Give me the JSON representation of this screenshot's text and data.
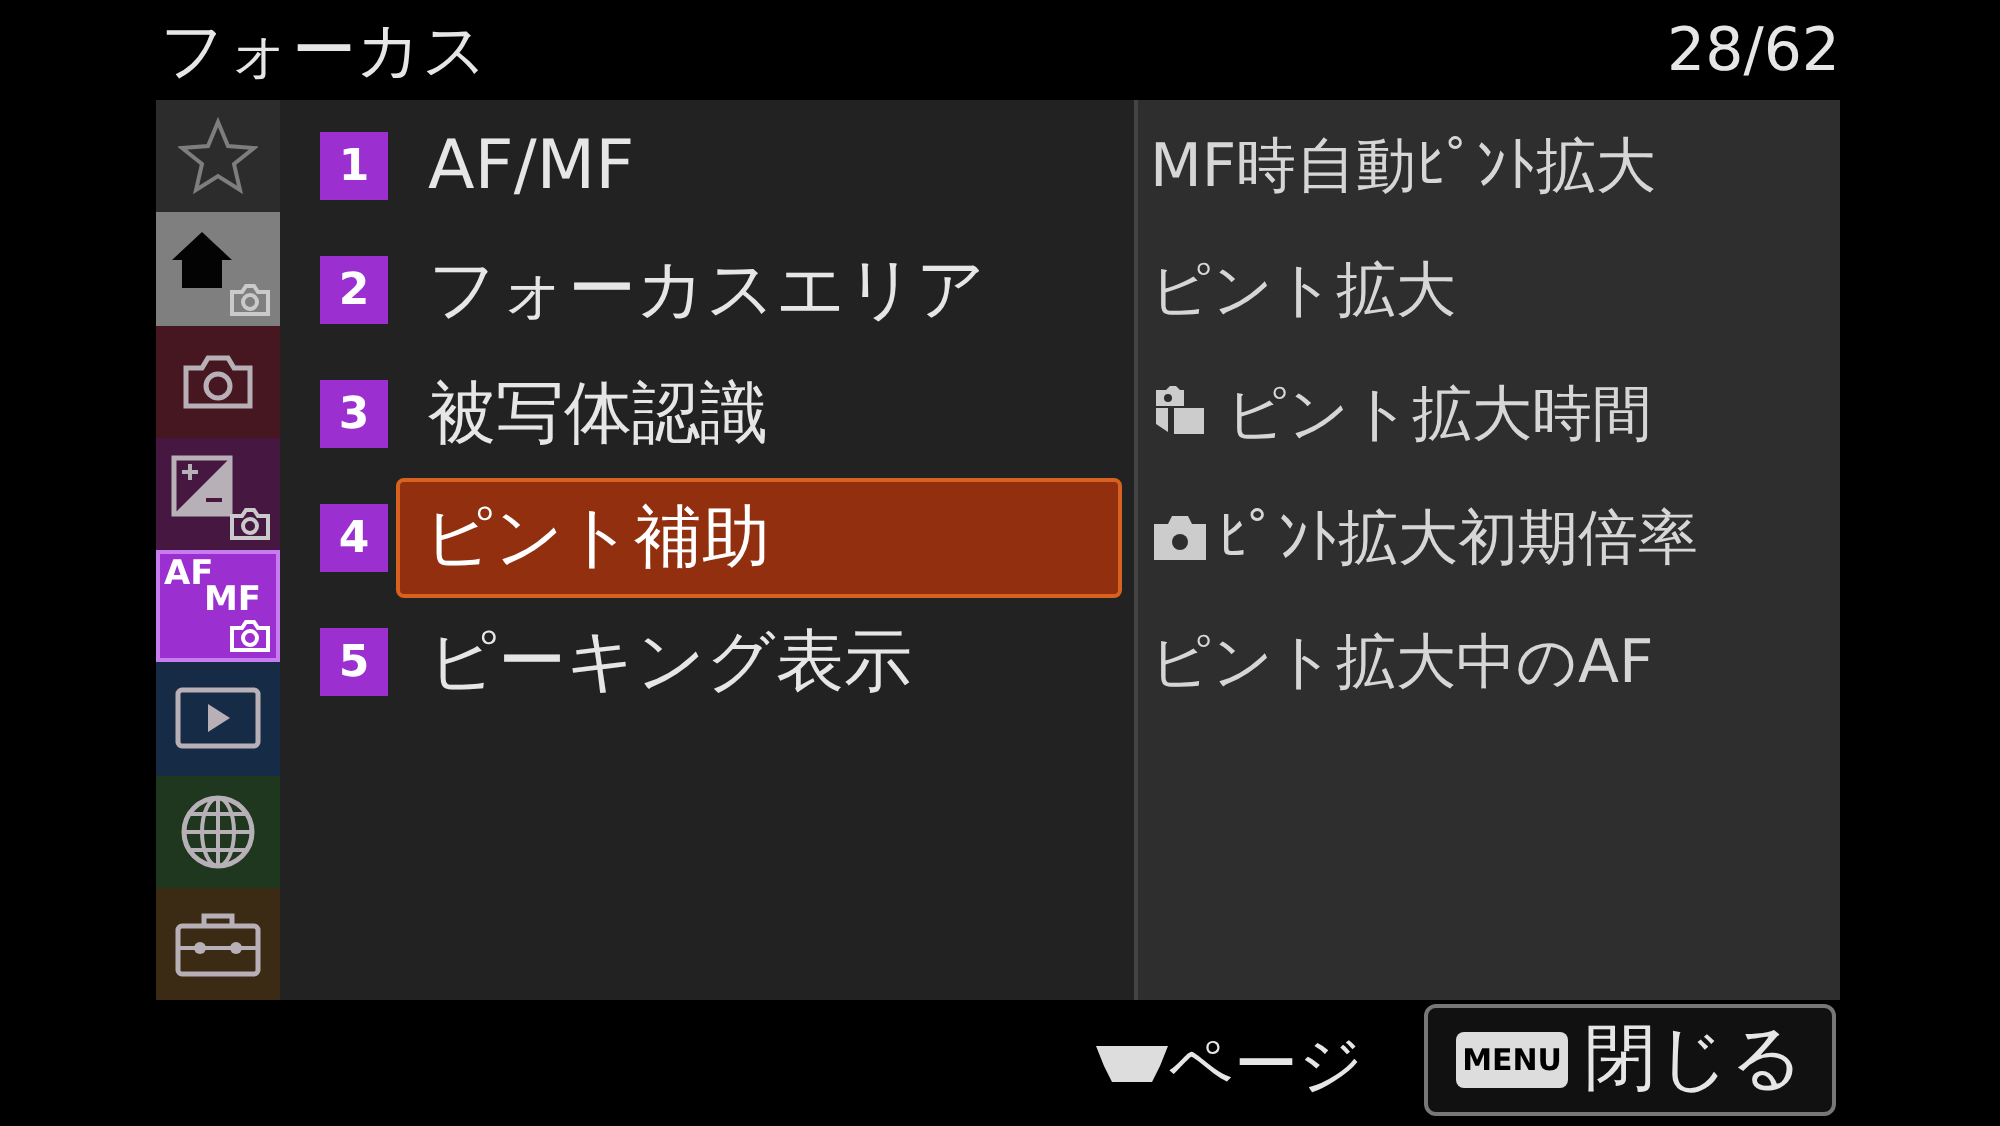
{
  "title": "フォーカス",
  "page_counter": "28/62",
  "tabs": [
    {
      "kind": "star",
      "color": "#2e2e2e",
      "selected": false
    },
    {
      "kind": "home",
      "color": "#8a8a8a",
      "selected": false
    },
    {
      "kind": "camera",
      "color": "#4a1620",
      "selected": false
    },
    {
      "kind": "exposure",
      "color": "#4a1845",
      "selected": false
    },
    {
      "kind": "afmf",
      "label_top": "AF",
      "label_bottom": "MF",
      "color": "#9b2fd0",
      "selected": true
    },
    {
      "kind": "play",
      "color": "#152e4a",
      "selected": false
    },
    {
      "kind": "globe",
      "color": "#1e3a1e",
      "selected": false
    },
    {
      "kind": "toolbox",
      "color": "#3e2c14",
      "selected": false
    }
  ],
  "items": [
    {
      "number": "1",
      "label": "AF/MF",
      "selected": false
    },
    {
      "number": "2",
      "label": "フォーカスエリア",
      "selected": false
    },
    {
      "number": "3",
      "label": "被写体認識",
      "selected": false
    },
    {
      "number": "4",
      "label": "ピント補助",
      "selected": true
    },
    {
      "number": "5",
      "label": "ピーキング表示",
      "selected": false
    }
  ],
  "submenu": [
    {
      "label": "MF時自動ﾋﾟﾝﾄ拡大"
    },
    {
      "label": "ピント拡大"
    },
    {
      "label": "ピント拡大時間",
      "kind": "photo-video"
    },
    {
      "label": "ﾋﾟﾝﾄ拡大初期倍率",
      "kind": "camera"
    },
    {
      "label": "ピント拡大中のAF"
    }
  ],
  "footer": {
    "page": "ページ",
    "close_key": "MENU",
    "close": "閉じる"
  }
}
